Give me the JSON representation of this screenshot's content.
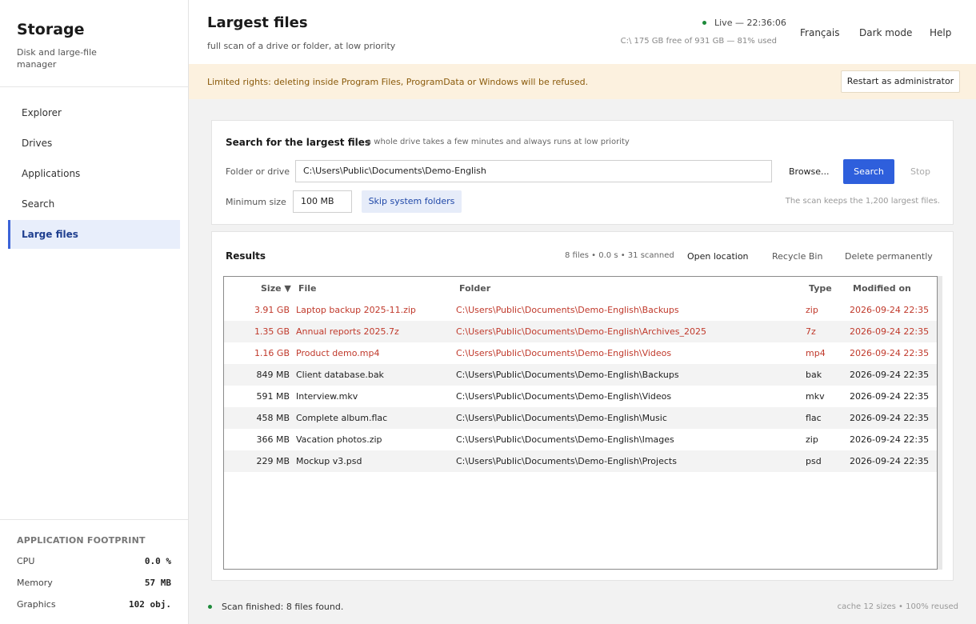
{
  "sidebar": {
    "brand_title": "Storage",
    "brand_sub": "Disk and large-file manager",
    "items": [
      {
        "label": "Explorer"
      },
      {
        "label": "Drives"
      },
      {
        "label": "Applications"
      },
      {
        "label": "Search"
      },
      {
        "label": "Large files",
        "active": true
      }
    ],
    "footprint": {
      "title": "APPLICATION FOOTPRINT",
      "rows": [
        {
          "label": "CPU",
          "value": "0.0 %"
        },
        {
          "label": "Memory",
          "value": "57 MB"
        },
        {
          "label": "Graphics",
          "value": "102 obj."
        }
      ]
    }
  },
  "header": {
    "title": "Largest files",
    "subtitle": "full scan of a drive or folder, at low priority",
    "live": "Live — 22:36:06",
    "disk": "C:\\ 175 GB free of 931 GB — 81% used",
    "lang": "Français",
    "dark_mode": "Dark mode",
    "help": "Help"
  },
  "banner": {
    "text": "Limited rights: deleting inside Program Files, ProgramData or Windows will be refused.",
    "button": "Restart as administrator"
  },
  "search": {
    "title": "Search for the largest files",
    "hint": "a whole drive takes a few minutes and always runs at low priority",
    "folder_label": "Folder or drive",
    "folder_value": "C:\\Users\\Public\\Documents\\Demo-English",
    "browse": "Browse...",
    "search": "Search",
    "stop": "Stop",
    "min_label": "Minimum size",
    "min_value": "100 MB",
    "skip": "Skip system folders",
    "note": "The scan keeps the 1,200 largest files."
  },
  "results": {
    "title": "Results",
    "stats": "8 files • 0.0 s • 31 scanned",
    "open_location": "Open location",
    "recycle": "Recycle Bin",
    "delete": "Delete permanently",
    "columns": {
      "size": "Size ▼",
      "file": "File",
      "folder": "Folder",
      "type": "Type",
      "modified": "Modified on"
    },
    "rows": [
      {
        "size": "3.91 GB",
        "file": "Laptop backup 2025-11.zip",
        "folder": "C:\\Users\\Public\\Documents\\Demo-English\\Backups",
        "type": "zip",
        "modified": "2026-09-24 22:35",
        "highlight": true
      },
      {
        "size": "1.35 GB",
        "file": "Annual reports 2025.7z",
        "folder": "C:\\Users\\Public\\Documents\\Demo-English\\Archives_2025",
        "type": "7z",
        "modified": "2026-09-24 22:35",
        "highlight": true
      },
      {
        "size": "1.16 GB",
        "file": "Product demo.mp4",
        "folder": "C:\\Users\\Public\\Documents\\Demo-English\\Videos",
        "type": "mp4",
        "modified": "2026-09-24 22:35",
        "highlight": true
      },
      {
        "size": "849 MB",
        "file": "Client database.bak",
        "folder": "C:\\Users\\Public\\Documents\\Demo-English\\Backups",
        "type": "bak",
        "modified": "2026-09-24 22:35",
        "highlight": false
      },
      {
        "size": "591 MB",
        "file": "Interview.mkv",
        "folder": "C:\\Users\\Public\\Documents\\Demo-English\\Videos",
        "type": "mkv",
        "modified": "2026-09-24 22:35",
        "highlight": false
      },
      {
        "size": "458 MB",
        "file": "Complete album.flac",
        "folder": "C:\\Users\\Public\\Documents\\Demo-English\\Music",
        "type": "flac",
        "modified": "2026-09-24 22:35",
        "highlight": false
      },
      {
        "size": "366 MB",
        "file": "Vacation photos.zip",
        "folder": "C:\\Users\\Public\\Documents\\Demo-English\\Images",
        "type": "zip",
        "modified": "2026-09-24 22:35",
        "highlight": false
      },
      {
        "size": "229 MB",
        "file": "Mockup v3.psd",
        "folder": "C:\\Users\\Public\\Documents\\Demo-English\\Projects",
        "type": "psd",
        "modified": "2026-09-24 22:35",
        "highlight": false
      }
    ]
  },
  "status": {
    "text": "Scan finished: 8 files found.",
    "cache": "cache 12 sizes • 100% reused"
  },
  "colors": {
    "accent": "#2e5fdc",
    "highlight_row": "#c0392b",
    "banner_bg": "#fcf1df",
    "live_dot": "#1d8a3a"
  }
}
